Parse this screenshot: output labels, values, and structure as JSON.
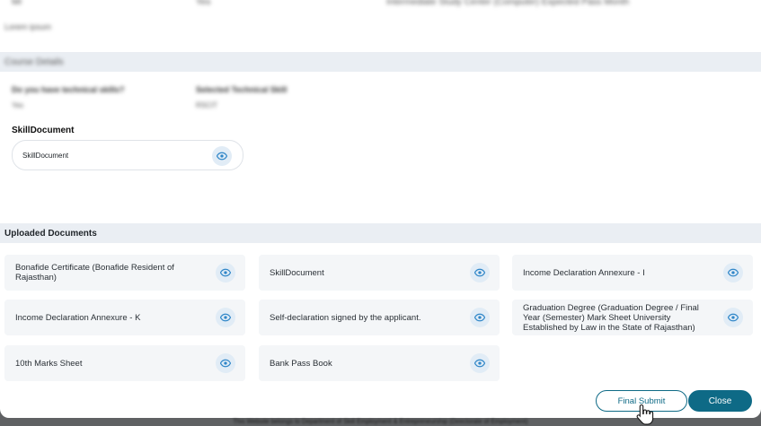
{
  "blurred": {
    "top_row": [
      "Mr",
      "Yes",
      "Intermediate Study Center (Computer) Expected Pass Month"
    ],
    "outlined_caption": "Lorem ipsum",
    "course_details_title": "Course Details",
    "q_label": "Do you have technical skills?",
    "q_value": "Yes",
    "skill_label": "Selected Technical Skill",
    "skill_value": "RSCIT",
    "footer": "This Website belongs to Department of Skill Employment & Entrepreneurship (Directorate of Employment)"
  },
  "skill_section": {
    "title": "SkillDocument",
    "file_label": "SkillDocument"
  },
  "uploaded": {
    "title": "Uploaded Documents",
    "docs": [
      {
        "label": "Bonafide Certificate (Bonafide Resident of Rajasthan)"
      },
      {
        "label": "SkillDocument"
      },
      {
        "label": "Income Declaration Annexure - I"
      },
      {
        "label": "Income Declaration Annexure - K"
      },
      {
        "label": "Self-declaration signed by the applicant."
      },
      {
        "label": "Graduation Degree (Graduation Degree / Final Year (Semester) Mark Sheet University Established by Law in the State of Rajasthan)"
      },
      {
        "label": "10th Marks Sheet"
      },
      {
        "label": "Bank Pass Book"
      }
    ]
  },
  "actions": {
    "final_submit": "Final Submit",
    "close": "Close"
  },
  "colors": {
    "accent": "#0e6a86",
    "eye_icon": "#2f86c8",
    "card_bg": "#f4f6f8",
    "section_bar": "#eaeef3"
  }
}
